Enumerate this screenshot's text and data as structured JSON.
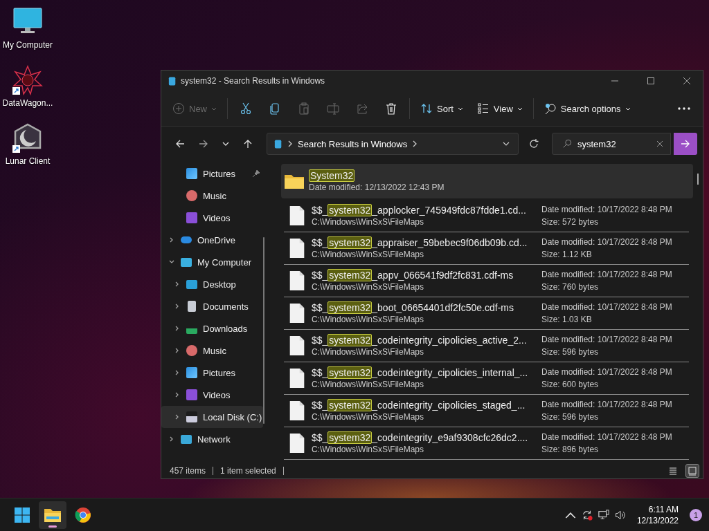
{
  "desktop_icons": [
    {
      "label": "My Computer",
      "kind": "computer",
      "shortcut": false
    },
    {
      "label": "DataWagon...",
      "kind": "star",
      "shortcut": true
    },
    {
      "label": "Lunar Client",
      "kind": "moon",
      "shortcut": true
    }
  ],
  "window": {
    "title": "system32 - Search Results in Windows"
  },
  "toolbar": [
    {
      "kind": "new",
      "label": "New",
      "disabled": true
    },
    {
      "kind": "cut",
      "disabled": false
    },
    {
      "kind": "copy",
      "disabled": false
    },
    {
      "kind": "paste",
      "disabled": true
    },
    {
      "kind": "rename",
      "disabled": true
    },
    {
      "kind": "share",
      "disabled": true
    },
    {
      "kind": "delete",
      "disabled": false
    },
    {
      "kind": "sort",
      "label": "Sort",
      "disabled": false
    },
    {
      "kind": "view",
      "label": "View",
      "disabled": false
    },
    {
      "kind": "search_options",
      "label": "Search options",
      "disabled": false
    },
    {
      "kind": "more",
      "disabled": false
    }
  ],
  "address": {
    "location": "Search Results in Windows"
  },
  "search": {
    "value": "system32"
  },
  "sidebar": {
    "pinned_items": [
      {
        "label": "Pictures",
        "kind": "pictures",
        "pinned": true
      },
      {
        "label": "Music",
        "kind": "music",
        "pinned": false
      },
      {
        "label": "Videos",
        "kind": "videos",
        "pinned": false
      }
    ],
    "tree": [
      {
        "label": "OneDrive",
        "kind": "cloud",
        "expanded": false,
        "selected": false
      },
      {
        "label": "My Computer",
        "kind": "computer",
        "expanded": true,
        "selected": false,
        "children": [
          {
            "label": "Desktop",
            "kind": "desktop",
            "expanded": false,
            "selected": false
          },
          {
            "label": "Documents",
            "kind": "documents",
            "expanded": false,
            "selected": false
          },
          {
            "label": "Downloads",
            "kind": "downloads",
            "expanded": false,
            "selected": false
          },
          {
            "label": "Music",
            "kind": "music",
            "expanded": false,
            "selected": false
          },
          {
            "label": "Pictures",
            "kind": "pictures",
            "expanded": false,
            "selected": false
          },
          {
            "label": "Videos",
            "kind": "videos",
            "expanded": false,
            "selected": false
          },
          {
            "label": "Local Disk (C:)",
            "kind": "disk",
            "expanded": false,
            "selected": true
          }
        ]
      },
      {
        "label": "Network",
        "kind": "network",
        "expanded": false,
        "selected": false
      }
    ]
  },
  "results": [
    {
      "kind": "folder",
      "match": "System32",
      "detail": "Date modified:  12/13/2022 12:43 PM",
      "selected": true
    },
    {
      "kind": "file",
      "name_start": "$$_",
      "match": "system32",
      "name_end": "_applocker_745949fdc87fdde1.cd...",
      "path": "C:\\Windows\\WinSxS\\FileMaps",
      "date": "Date modified:  10/17/2022 8:48 PM",
      "size": "Size:  572 bytes",
      "selected": false
    },
    {
      "kind": "file",
      "name_start": "$$_",
      "match": "system32",
      "name_end": "_appraiser_59bebec9f06db09b.cd...",
      "path": "C:\\Windows\\WinSxS\\FileMaps",
      "date": "Date modified:  10/17/2022 8:48 PM",
      "size": "Size:  1.12 KB",
      "selected": false
    },
    {
      "kind": "file",
      "name_start": "$$_",
      "match": "system32",
      "name_end": "_appv_066541f9df2fc831.cdf-ms",
      "path": "C:\\Windows\\WinSxS\\FileMaps",
      "date": "Date modified:  10/17/2022 8:48 PM",
      "size": "Size:  760 bytes",
      "selected": false
    },
    {
      "kind": "file",
      "name_start": "$$_",
      "match": "system32",
      "name_end": "_boot_06654401df2fc50e.cdf-ms",
      "path": "C:\\Windows\\WinSxS\\FileMaps",
      "date": "Date modified:  10/17/2022 8:48 PM",
      "size": "Size:  1.03 KB",
      "selected": false
    },
    {
      "kind": "file",
      "name_start": "$$_",
      "match": "system32",
      "name_end": "_codeintegrity_cipolicies_active_2...",
      "path": "C:\\Windows\\WinSxS\\FileMaps",
      "date": "Date modified:  10/17/2022 8:48 PM",
      "size": "Size:  596 bytes",
      "selected": false
    },
    {
      "kind": "file",
      "name_start": "$$_",
      "match": "system32",
      "name_end": "_codeintegrity_cipolicies_internal_...",
      "path": "C:\\Windows\\WinSxS\\FileMaps",
      "date": "Date modified:  10/17/2022 8:48 PM",
      "size": "Size:  600 bytes",
      "selected": false
    },
    {
      "kind": "file",
      "name_start": "$$_",
      "match": "system32",
      "name_end": "_codeintegrity_cipolicies_staged_...",
      "path": "C:\\Windows\\WinSxS\\FileMaps",
      "date": "Date modified:  10/17/2022 8:48 PM",
      "size": "Size:  596 bytes",
      "selected": false
    },
    {
      "kind": "file",
      "name_start": "$$_",
      "match": "system32",
      "name_end": "_codeintegrity_e9af9308cfc26dc2....",
      "path": "C:\\Windows\\WinSxS\\FileMaps",
      "date": "Date modified:  10/17/2022 8:48 PM",
      "size": "Size:  896 bytes",
      "selected": false
    }
  ],
  "status_bar": {
    "count": "457 items",
    "selection": "1 item selected"
  },
  "view_buttons": [
    {
      "kind": "details",
      "selected": false
    },
    {
      "kind": "tiles",
      "selected": true
    }
  ],
  "taskbar": {
    "apps": [
      {
        "kind": "start",
        "active": false
      },
      {
        "kind": "explorer",
        "active": true
      },
      {
        "kind": "chrome",
        "active": false
      }
    ],
    "clock": {
      "time": "6:11 AM",
      "date": "12/13/2022"
    },
    "notification_count": "1"
  }
}
